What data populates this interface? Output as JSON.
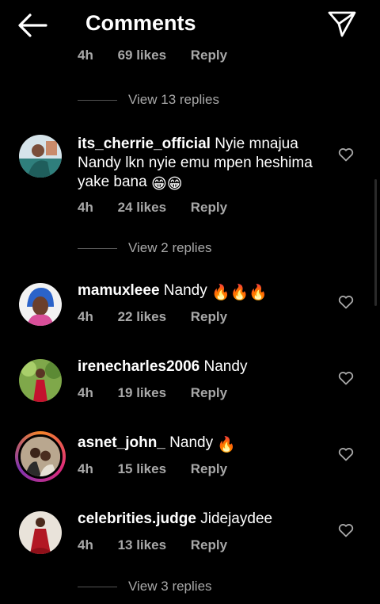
{
  "header": {
    "title": "Comments",
    "back_icon": "arrow-left-icon",
    "send_icon": "paper-plane-icon"
  },
  "previous_comment": {
    "time": "4h",
    "likes": "69 likes",
    "reply": "Reply"
  },
  "view_replies": [
    "View 13 replies",
    "View 2 replies",
    "View 3 replies"
  ],
  "comments": [
    {
      "username": "its_cherrie_official",
      "text": "Nyie mnajua Nandy lkn nyie emu mpen heshima yake bana",
      "emoji": "😁😁",
      "time": "4h",
      "likes": "24 likes",
      "reply": "Reply"
    },
    {
      "username": "mamuxleee",
      "text": "Nandy",
      "emoji": "🔥🔥🔥",
      "time": "4h",
      "likes": "22 likes",
      "reply": "Reply"
    },
    {
      "username": "irenecharles2006",
      "text": "Nandy",
      "emoji": "",
      "time": "4h",
      "likes": "19 likes",
      "reply": "Reply"
    },
    {
      "username": "asnet_john_",
      "text": "Nandy",
      "emoji": "🔥",
      "time": "4h",
      "likes": "15 likes",
      "reply": "Reply"
    },
    {
      "username": "celebrities.judge",
      "text": "Jidejaydee",
      "emoji": "",
      "time": "4h",
      "likes": "13 likes",
      "reply": "Reply"
    }
  ],
  "colors": {
    "background": "#000000",
    "text": "#ffffff",
    "secondary": "#a8a8a8",
    "story_ring": "#dd2a7b"
  }
}
